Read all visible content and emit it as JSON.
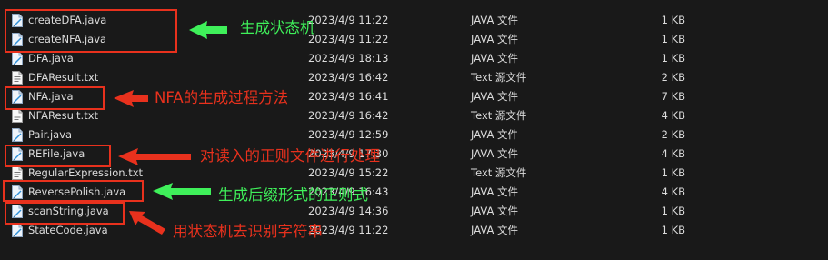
{
  "files": [
    {
      "name": "createDFA.java",
      "modified": "2023/4/9 11:22",
      "type": "JAVA 文件",
      "size": "1 KB",
      "icon": "java-file-icon"
    },
    {
      "name": "createNFA.java",
      "modified": "2023/4/9 11:22",
      "type": "JAVA 文件",
      "size": "1 KB",
      "icon": "java-file-icon"
    },
    {
      "name": "DFA.java",
      "modified": "2023/4/9 18:13",
      "type": "JAVA 文件",
      "size": "1 KB",
      "icon": "java-file-icon"
    },
    {
      "name": "DFAResult.txt",
      "modified": "2023/4/9 16:42",
      "type": "Text 源文件",
      "size": "2 KB",
      "icon": "text-file-icon"
    },
    {
      "name": "NFA.java",
      "modified": "2023/4/9 16:41",
      "type": "JAVA 文件",
      "size": "7 KB",
      "icon": "java-file-icon"
    },
    {
      "name": "NFAResult.txt",
      "modified": "2023/4/9 16:42",
      "type": "Text 源文件",
      "size": "4 KB",
      "icon": "text-file-icon"
    },
    {
      "name": "Pair.java",
      "modified": "2023/4/9 12:59",
      "type": "JAVA 文件",
      "size": "2 KB",
      "icon": "java-file-icon"
    },
    {
      "name": "REFile.java",
      "modified": "2023/4/9 17:30",
      "type": "JAVA 文件",
      "size": "4 KB",
      "icon": "java-file-icon"
    },
    {
      "name": "RegularExpression.txt",
      "modified": "2023/4/9 15:22",
      "type": "Text 源文件",
      "size": "1 KB",
      "icon": "text-file-icon"
    },
    {
      "name": "ReversePolish.java",
      "modified": "2023/4/9 16:43",
      "type": "JAVA 文件",
      "size": "4 KB",
      "icon": "java-file-icon"
    },
    {
      "name": "scanString.java",
      "modified": "2023/4/9 14:36",
      "type": "JAVA 文件",
      "size": "1 KB",
      "icon": "java-file-icon"
    },
    {
      "name": "StateCode.java",
      "modified": "2023/4/9 11:22",
      "type": "JAVA 文件",
      "size": "1 KB",
      "icon": "java-file-icon"
    }
  ],
  "annotations": [
    {
      "text": "生成状态机",
      "color": "#3ff05a"
    },
    {
      "text": "NFA的生成过程方法",
      "color": "#e8311d"
    },
    {
      "text": "对读入的正则文件进行处理",
      "color": "#e8311d"
    },
    {
      "text": "生成后缀形式的正则式",
      "color": "#3ff05a"
    },
    {
      "text": "用状态机去识别字符串",
      "color": "#e8311d"
    }
  ],
  "colors": {
    "background": "#191919",
    "text": "#dcdcdc",
    "box": "#e8311d",
    "green": "#3ff05a",
    "red": "#e8311d"
  }
}
